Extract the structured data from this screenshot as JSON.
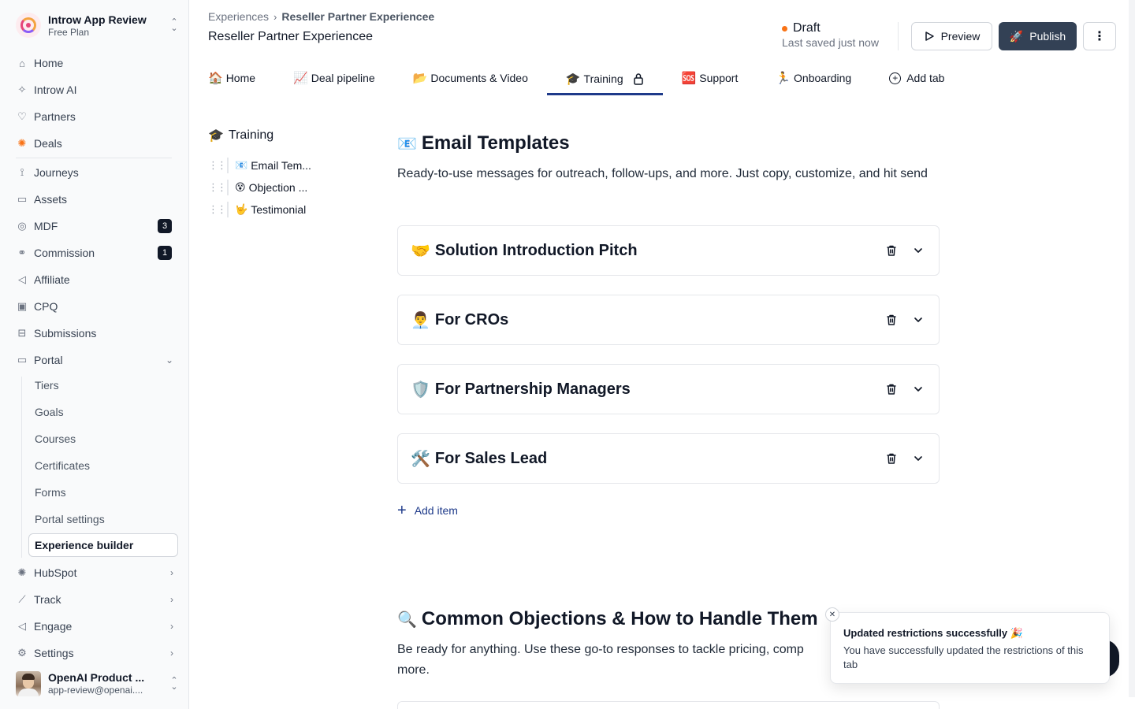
{
  "workspace": {
    "name": "Introw App Review",
    "plan": "Free Plan"
  },
  "sidebar": {
    "items": [
      {
        "label": "Home",
        "icon": "home-icon",
        "glyph": "⌂"
      },
      {
        "label": "Introw AI",
        "icon": "sparkle-icon",
        "glyph": "✧"
      },
      {
        "label": "Partners",
        "icon": "handshake-icon",
        "glyph": "♡"
      },
      {
        "label": "Deals",
        "icon": "hubspot-icon",
        "glyph": "✺"
      },
      {
        "label": "Journeys",
        "icon": "route-icon",
        "glyph": "⟟"
      },
      {
        "label": "Assets",
        "icon": "folder-icon",
        "glyph": "▭"
      },
      {
        "label": "MDF",
        "icon": "coins-icon",
        "glyph": "◎",
        "badge": "3"
      },
      {
        "label": "Commission",
        "icon": "link-icon",
        "glyph": "⚭",
        "badge": "1"
      },
      {
        "label": "Affiliate",
        "icon": "megaphone-icon",
        "glyph": "◁"
      },
      {
        "label": "CPQ",
        "icon": "calculator-icon",
        "glyph": "▣"
      },
      {
        "label": "Submissions",
        "icon": "inbox-icon",
        "glyph": "⊟"
      },
      {
        "label": "Portal",
        "icon": "monitor-icon",
        "glyph": "▭"
      }
    ],
    "portal_sub": [
      "Tiers",
      "Goals",
      "Courses",
      "Certificates",
      "Forms",
      "Portal settings",
      "Experience builder"
    ],
    "bottom_items": [
      {
        "label": "HubSpot",
        "icon": "hubspot-icon",
        "glyph": "✺"
      },
      {
        "label": "Track",
        "icon": "chart-icon",
        "glyph": "⟋"
      },
      {
        "label": "Engage",
        "icon": "megaphone-icon",
        "glyph": "◁"
      },
      {
        "label": "Settings",
        "icon": "gear-icon",
        "glyph": "⚙"
      }
    ]
  },
  "user": {
    "name": "OpenAI Product ...",
    "email": "app-review@openai...."
  },
  "header": {
    "breadcrumb_parent": "Experiences",
    "breadcrumb_current": "Reseller Partner Experiencee",
    "title": "Reseller Partner Experiencee",
    "status": "Draft",
    "saved": "Last saved just now",
    "preview_label": "Preview",
    "publish_label": "Publish"
  },
  "tabs": [
    {
      "emoji": "🏠",
      "label": "Home"
    },
    {
      "emoji": "📈",
      "label": "Deal pipeline"
    },
    {
      "emoji": "📂",
      "label": "Documents & Video"
    },
    {
      "emoji": "🎓",
      "label": "Training",
      "active": true,
      "locked": true
    },
    {
      "emoji": "🆘",
      "label": "Support"
    },
    {
      "emoji": "🏃",
      "label": "Onboarding"
    }
  ],
  "add_tab_label": "Add tab",
  "toc": {
    "emoji": "🎓",
    "title": "Training",
    "items": [
      {
        "emoji": "📧",
        "label": "Email Tem..."
      },
      {
        "emoji": "😵",
        "label": "Objection ..."
      },
      {
        "emoji": "🤟",
        "label": "Testimonial"
      }
    ]
  },
  "sections": [
    {
      "emoji": "📧",
      "title": "Email Templates",
      "description": "Ready-to-use messages for outreach, follow-ups, and more. Just copy, customize, and hit send",
      "cards": [
        {
          "emoji": "🤝",
          "title": "Solution Introduction Pitch"
        },
        {
          "emoji": "👨‍💼",
          "title": "For CROs"
        },
        {
          "emoji": "🛡️",
          "title": "For Partnership Managers"
        },
        {
          "emoji": "🛠️",
          "title": "For Sales Lead"
        }
      ],
      "add_item_label": "Add item"
    },
    {
      "emoji": "🔍",
      "title": "Common Objections & How to Handle Them",
      "description": "Be ready for anything. Use these go-to responses to tackle pricing, comp",
      "description_2": "more."
    }
  ],
  "toast": {
    "title": "Updated restrictions successfully 🎉",
    "message": "You have successfully updated the restrictions of this tab"
  }
}
